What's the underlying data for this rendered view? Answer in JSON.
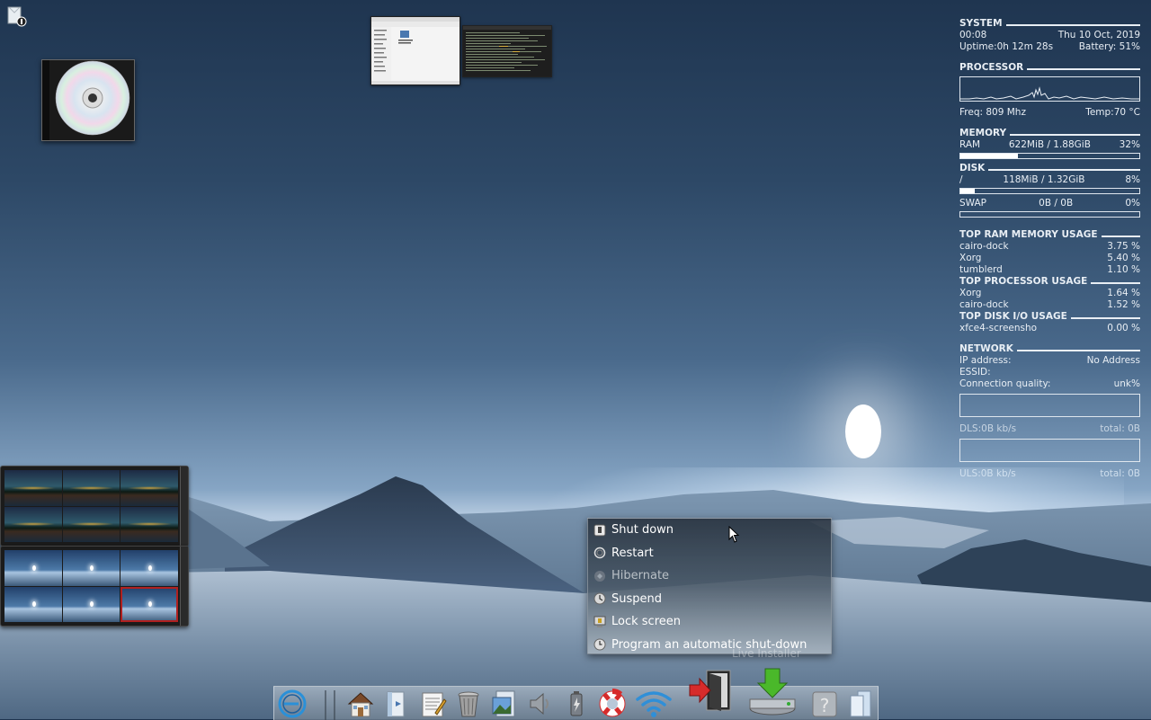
{
  "conky": {
    "system": {
      "title": "SYSTEM",
      "time": "00:08",
      "date": "Thu 10 Oct, 2019",
      "uptime": "Uptime:0h 12m 28s",
      "battery": "Battery: 51%"
    },
    "processor": {
      "title": "PROCESSOR",
      "freq": "Freq: 809 Mhz",
      "temp": "Temp:70 °C"
    },
    "memory": {
      "title": "MEMORY",
      "label": "RAM",
      "usage": "622MiB / 1.88GiB",
      "percent": "32%",
      "fraction": 0.32
    },
    "disk": {
      "title": "DISK",
      "mount": "/",
      "usage": "118MiB / 1.32GiB",
      "percent": "8%",
      "fraction": 0.08,
      "swap_label": "SWAP",
      "swap_usage": "0B  / 0B",
      "swap_percent": "0%"
    },
    "top_ram": {
      "title": "TOP RAM MEMORY USAGE",
      "rows": [
        {
          "name": "cairo-dock",
          "value": "3.75 %"
        },
        {
          "name": "Xorg",
          "value": "5.40 %"
        },
        {
          "name": "tumblerd",
          "value": "1.10 %"
        }
      ]
    },
    "top_cpu": {
      "title": "TOP PROCESSOR USAGE",
      "rows": [
        {
          "name": "Xorg",
          "value": "1.64 %"
        },
        {
          "name": "cairo-dock",
          "value": "1.52 %"
        }
      ]
    },
    "top_io": {
      "title": "TOP DISK I/O USAGE",
      "rows": [
        {
          "name": "xfce4-screensho",
          "value": "0.00 %"
        }
      ]
    },
    "network": {
      "title": "NETWORK",
      "ip_label": "IP address:",
      "ip_value": "No Address",
      "essid_label": "ESSID:",
      "quality_label": "Connection quality:",
      "quality_value": "unk%",
      "dls_label": "DLS:0B   kb/s",
      "dls_total": "total: 0B",
      "uls_label": "ULS:0B   kb/s",
      "uls_total": "total: 0B"
    }
  },
  "logout_menu": {
    "items": [
      {
        "label": "Shut down",
        "icon": "power-icon",
        "enabled": true
      },
      {
        "label": "Restart",
        "icon": "restart-icon",
        "enabled": true
      },
      {
        "label": "Hibernate",
        "icon": "hibernate-icon",
        "enabled": false
      },
      {
        "label": "Suspend",
        "icon": "suspend-icon",
        "enabled": true
      },
      {
        "label": "Lock screen",
        "icon": "lock-icon",
        "enabled": true
      },
      {
        "label": "Program an automatic shut-down",
        "icon": "clock-icon",
        "enabled": true
      }
    ],
    "ghost_label": "Live Installer"
  },
  "dock": {
    "items": [
      "app-menu-icon",
      "home-folder-icon",
      "file-manager-icon",
      "text-editor-icon",
      "trash-icon",
      "image-viewer-icon",
      "volume-icon",
      "power-manager-icon",
      "help-lifebuoy-icon",
      "wifi-icon",
      "logout-icon",
      "live-installer-icon",
      "help-question-icon",
      "window-list-icon"
    ]
  },
  "colors": {
    "conky_text": "#e8eef4",
    "menu_text": "#ffffff",
    "accent_red": "#d62b2b",
    "wifi_blue": "#2f8fd8"
  }
}
